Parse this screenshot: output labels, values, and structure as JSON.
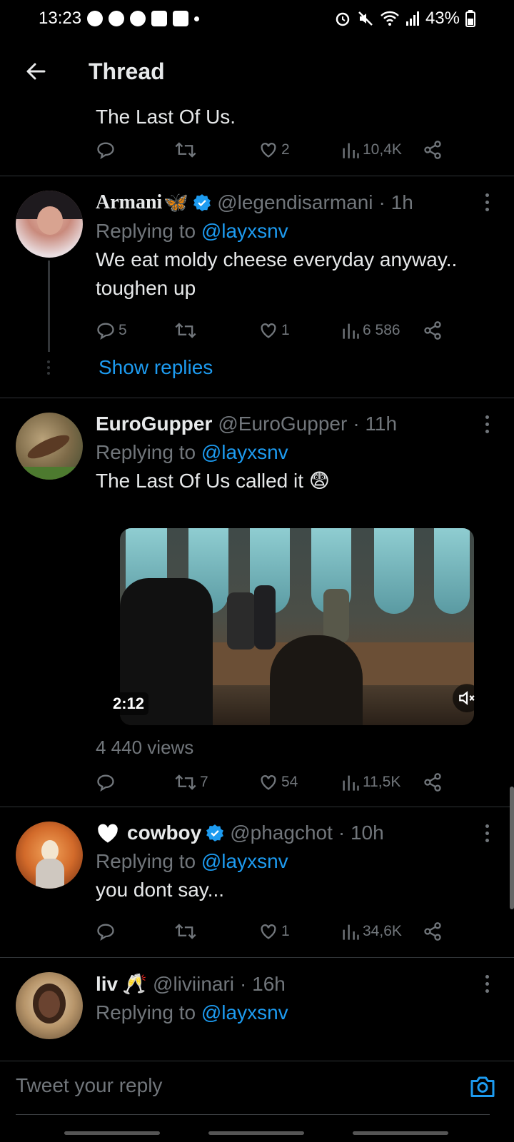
{
  "status_bar": {
    "time": "13:23",
    "battery": "43%"
  },
  "header": {
    "title": "Thread"
  },
  "top_tweet": {
    "text": "The Last Of Us.",
    "likes": "2",
    "views": "10,4K"
  },
  "tweets": [
    {
      "name": "Armani",
      "emoji": "🦋",
      "handle": "@legendisarmani",
      "time": "· 1h",
      "replying_prefix": "Replying to",
      "replying_to": "@layxsnv",
      "text": "We eat moldy cheese everyday anyway.. toughen up",
      "replies": "5",
      "retweets": "",
      "likes": "1",
      "views": "6 586",
      "show_replies": "Show replies"
    },
    {
      "name": "EuroGupper",
      "handle": "@EuroGupper",
      "time": "· 11h",
      "replying_prefix": "Replying to",
      "replying_to": "@layxsnv",
      "text": "The Last Of Us called it 😨",
      "video_duration": "2:12",
      "video_views": "4 440 views",
      "replies": "",
      "retweets": "7",
      "likes": "54",
      "views": "11,5K"
    },
    {
      "name": "cowboy",
      "handle": "@phagchot",
      "time": "· 10h",
      "replying_prefix": "Replying to",
      "replying_to": "@layxsnv",
      "text": "you dont say...",
      "replies": "",
      "retweets": "",
      "likes": "1",
      "views": "34,6K"
    },
    {
      "name": "liv",
      "emoji": "🥂",
      "handle": "@liviinari",
      "time": "· 16h",
      "replying_prefix": "Replying to",
      "replying_to": "@layxsnv"
    }
  ],
  "reply_bar": {
    "placeholder": "Tweet your reply"
  },
  "colors": {
    "accent": "#1d9bf0",
    "muted": "#71767b",
    "background": "#000000"
  }
}
